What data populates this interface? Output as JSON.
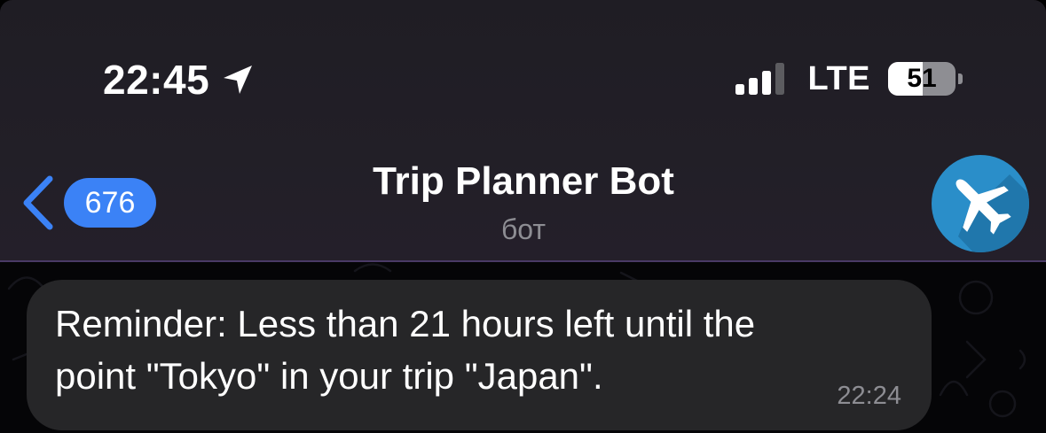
{
  "status_bar": {
    "time": "22:45",
    "location_icon": "location-arrow-icon",
    "signal_icon": "cellular-signal-icon",
    "network": "LTE",
    "battery_level": "51",
    "battery_fraction": 0.51
  },
  "nav": {
    "back_icon": "chevron-left-icon",
    "unread_count": "676",
    "title": "Trip Planner Bot",
    "subtitle": "бот",
    "avatar_icon": "airplane-icon",
    "avatar_color": "#2a8ec9",
    "badge_color": "#3b82f6"
  },
  "messages": [
    {
      "lines": [
        "Reminder: Less than 21 hours left until the",
        "point \"Tokyo\" in your trip \"Japan\"."
      ],
      "time": "22:24"
    }
  ]
}
